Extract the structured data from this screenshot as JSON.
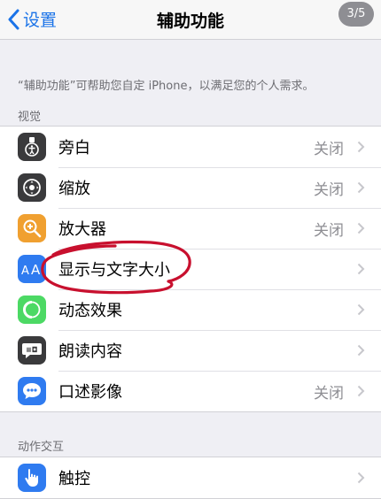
{
  "navbar": {
    "back_label": "设置",
    "title": "辅助功能",
    "page_indicator": "3/5"
  },
  "intro": "“辅助功能”可帮助您自定 iPhone，以满足您的个人需求。",
  "sections": {
    "vision": {
      "header": "视觉",
      "items": [
        {
          "label": "旁白",
          "value": "关闭",
          "icon": "voiceover-icon",
          "color": "#3a3a3c"
        },
        {
          "label": "缩放",
          "value": "关闭",
          "icon": "zoom-icon",
          "color": "#3a3a3c"
        },
        {
          "label": "放大器",
          "value": "关闭",
          "icon": "magnifier-icon",
          "color": "#f0a030"
        },
        {
          "label": "显示与文字大小",
          "value": "",
          "icon": "text-size-icon",
          "color": "#2f7bf0"
        },
        {
          "label": "动态效果",
          "value": "",
          "icon": "motion-icon",
          "color": "#4cd964"
        },
        {
          "label": "朗读内容",
          "value": "",
          "icon": "spoken-content-icon",
          "color": "#3a3a3c"
        },
        {
          "label": "口述影像",
          "value": "关闭",
          "icon": "audio-description-icon",
          "color": "#2f7bf0"
        }
      ]
    },
    "interaction": {
      "header": "动作交互",
      "items": [
        {
          "label": "触控",
          "value": "",
          "icon": "touch-icon",
          "color": "#2f7bf0"
        }
      ]
    }
  },
  "annotation": {
    "color": "#c8102e",
    "note": "red hand-drawn circle around 显示与文字大小"
  }
}
